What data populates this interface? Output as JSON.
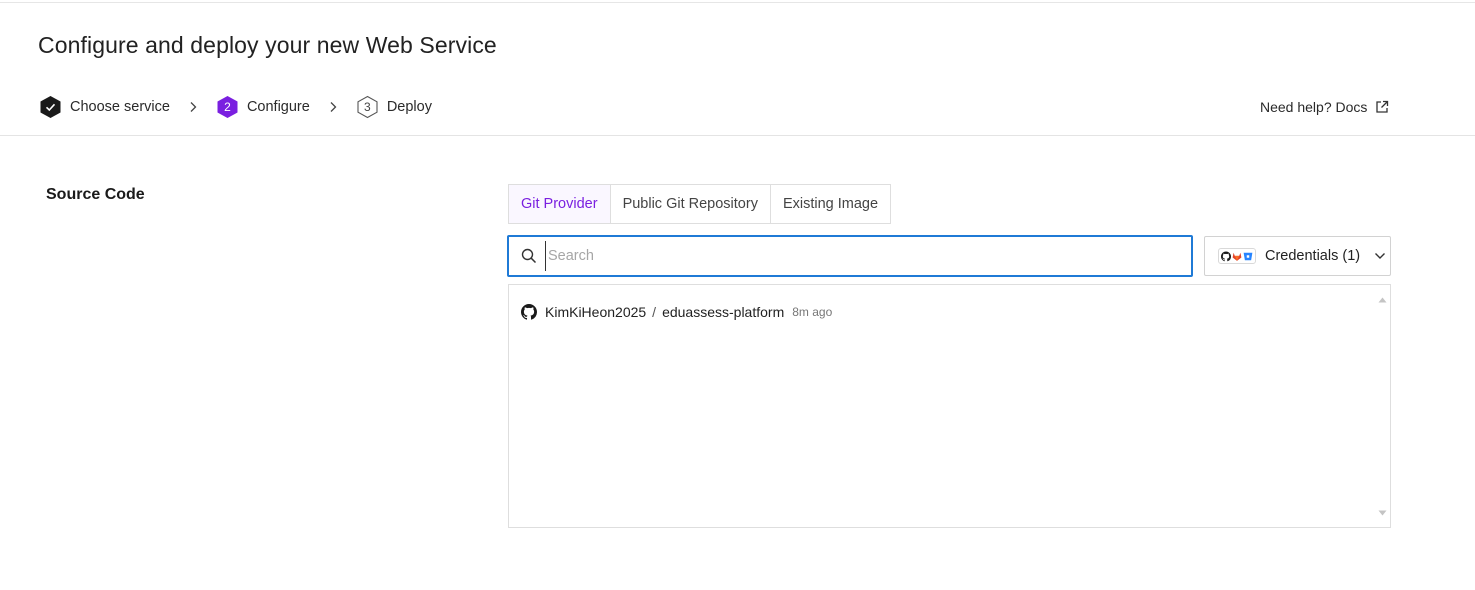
{
  "page": {
    "title": "Configure and deploy your new Web Service"
  },
  "steps": [
    {
      "label": "Choose service",
      "state": "done",
      "number": ""
    },
    {
      "label": "Configure",
      "state": "active",
      "number": "2"
    },
    {
      "label": "Deploy",
      "state": "pending",
      "number": "3"
    }
  ],
  "help": {
    "label": "Need help? Docs",
    "icon": "external-link-icon"
  },
  "source": {
    "section_label": "Source Code",
    "tabs": [
      {
        "label": "Git Provider",
        "active": true
      },
      {
        "label": "Public Git Repository",
        "active": false
      },
      {
        "label": "Existing Image",
        "active": false
      }
    ],
    "search": {
      "placeholder": "Search",
      "value": ""
    },
    "credentials": {
      "label": "Credentials (1)",
      "icons": [
        "github-icon",
        "gitlab-icon",
        "bitbucket-icon"
      ]
    },
    "repos": [
      {
        "owner": "KimKiHeon2025",
        "separator": "/",
        "name": "eduassess-platform",
        "updated": "8m ago",
        "icon": "github-icon"
      }
    ]
  },
  "colors": {
    "accent": "#7a1fe0",
    "focus": "#1f7ad6",
    "done": "#1a1a1a"
  }
}
